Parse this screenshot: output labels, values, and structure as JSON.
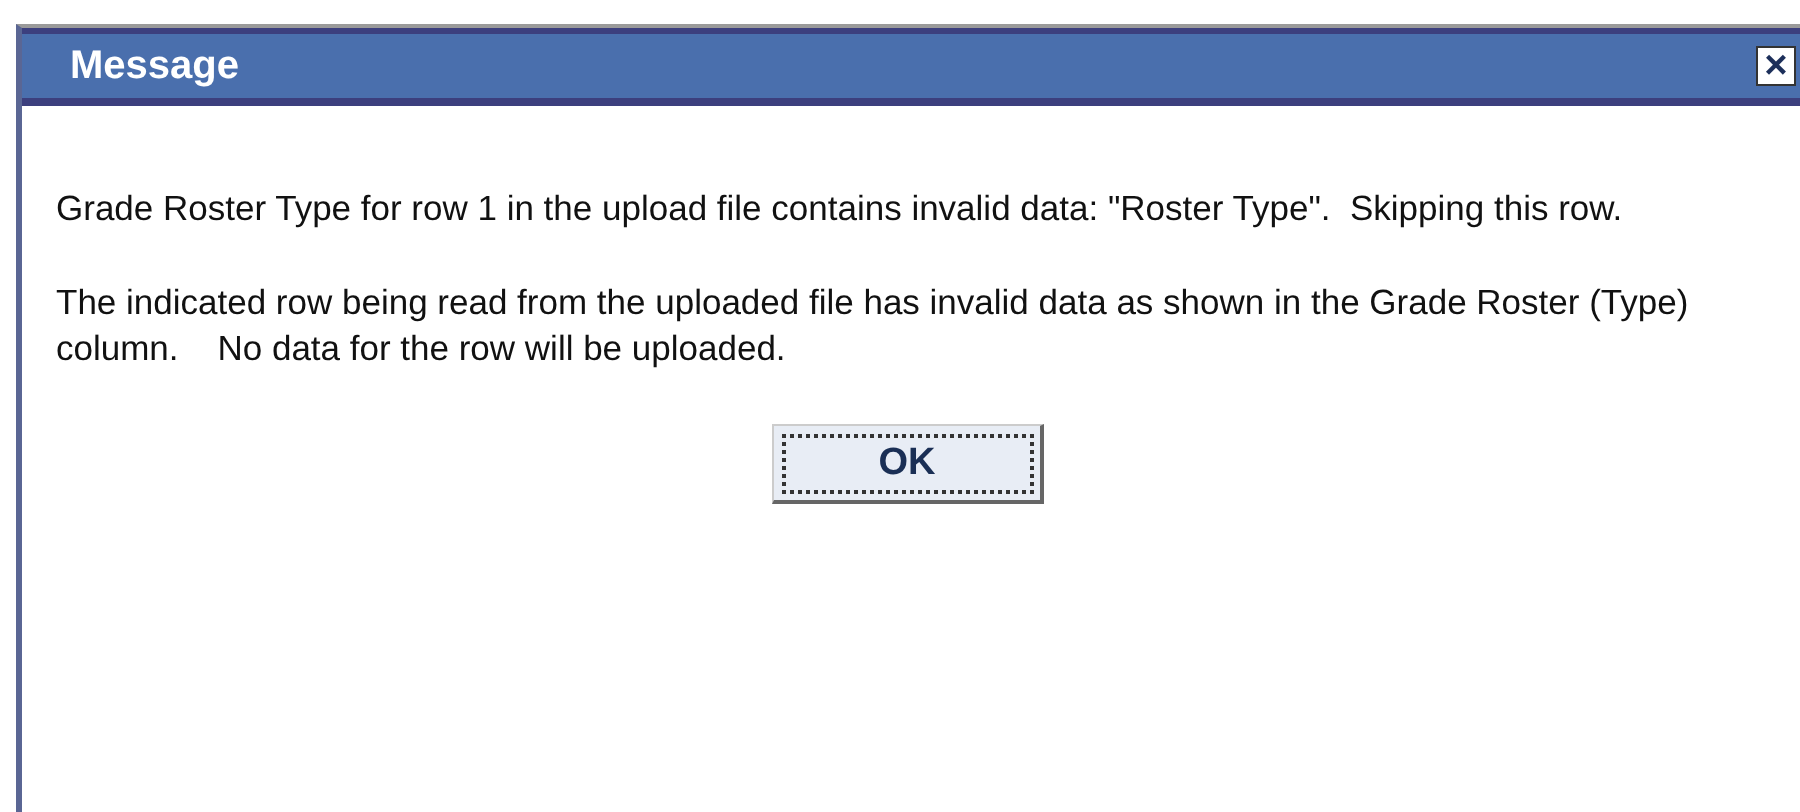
{
  "window": {
    "title": "Message",
    "close": "×"
  },
  "messages": [
    "Grade Roster Type for row 1 in the upload file contains invalid data: \"Roster Type\".  Skipping this row.",
    "The indicated row being read from the uploaded file has invalid data as shown in the Grade Roster (Type) column.    No data for the row will be uploaded."
  ],
  "buttons": [
    {
      "label": "OK",
      "focused": true
    }
  ]
}
